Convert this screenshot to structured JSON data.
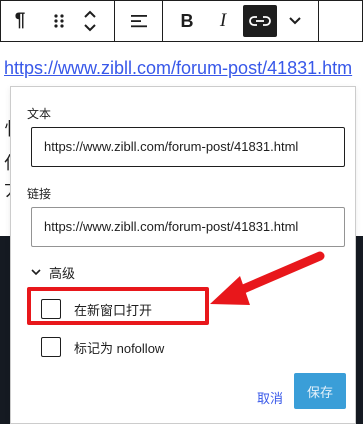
{
  "toolbar": {
    "items": [
      {
        "name": "paragraph-icon",
        "glyph": "¶"
      },
      {
        "name": "drag-handle-icon"
      },
      {
        "name": "move-up-down-icon"
      },
      {
        "name": "align-icon"
      },
      {
        "name": "bold-button",
        "glyph": "B"
      },
      {
        "name": "italic-button",
        "glyph": "I"
      },
      {
        "name": "link-icon"
      },
      {
        "name": "more-options-chevron-icon"
      }
    ],
    "bold": "B",
    "italic": "I",
    "paragraph": "¶"
  },
  "editor": {
    "link_text": "https://www.zibll.com/forum-post/41831.htm",
    "bg_line_1": "忄",
    "bg_line_2": "仫",
    "bg_line_3": "丆"
  },
  "link_popover": {
    "text_label": "文本",
    "text_value": "https://www.zibll.com/forum-post/41831.html",
    "link_label": "链接",
    "link_value": "https://www.zibll.com/forum-post/41831.html",
    "advanced_label": "高级",
    "options": [
      {
        "label": "在新窗口打开",
        "checked": false
      },
      {
        "label": "标记为 nofollow",
        "checked": false
      }
    ],
    "cancel_label": "取消",
    "save_label": "保存"
  },
  "colors": {
    "accent": "#3858e9",
    "save_button_bg": "#3a9ed8",
    "annotation_red": "#e8171b"
  }
}
